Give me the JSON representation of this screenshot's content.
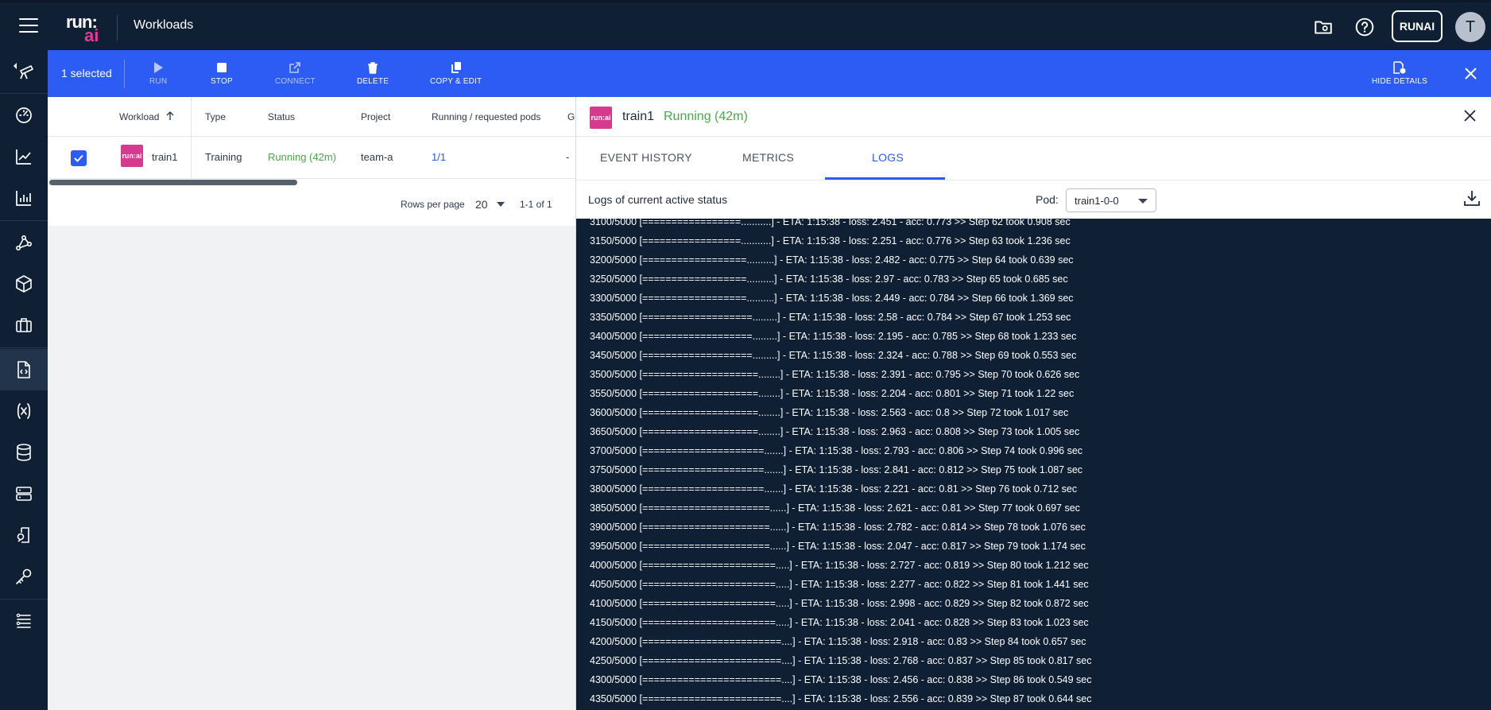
{
  "header": {
    "title": "Workloads",
    "logo_top": "run:",
    "logo_bottom": "ai",
    "org_button": "RUNAI",
    "avatar_letter": "T",
    "icons": [
      "folder-gear-icon",
      "help-icon"
    ]
  },
  "sidebar": {
    "items": [
      "telescope-icon",
      "dashboard-icon",
      "analytics-icon",
      "reports-icon",
      "network-icon",
      "models-icon",
      "briefcase-icon",
      "workloads-icon",
      "variable-icon",
      "datasets-icon",
      "servers-icon",
      "access-icon",
      "key-icon",
      "list-icon"
    ],
    "active_index": 7
  },
  "actionbar": {
    "selected": "1 selected",
    "buttons": [
      {
        "label": "RUN",
        "icon": "play-icon"
      },
      {
        "label": "STOP",
        "icon": "stop-icon"
      },
      {
        "label": "CONNECT",
        "icon": "external-link-icon"
      },
      {
        "label": "DELETE",
        "icon": "trash-icon"
      },
      {
        "label": "COPY & EDIT",
        "icon": "copy-icon"
      }
    ],
    "hide_details": "HIDE DETAILS"
  },
  "table": {
    "headers": [
      "Workload",
      "Type",
      "Status",
      "Project",
      "Running / requested pods",
      "GI"
    ],
    "row": {
      "logo": "run:ai",
      "workload": "train1",
      "type": "Training",
      "status": "Running (42m)",
      "project": "team-a",
      "pods": "1/1",
      "gpu": "-"
    },
    "pager": {
      "rows_per_page_label": "Rows per page",
      "rows_per_page": "20",
      "range": "1-1 of 1"
    }
  },
  "details": {
    "logo": "run:ai",
    "name": "train1",
    "status": "Running (42m)",
    "tabs": [
      "EVENT HISTORY",
      "METRICS",
      "LOGS"
    ],
    "active_tab": "LOGS",
    "logs_title": "Logs of current active status",
    "pod_label": "Pod:",
    "pod_value": "train1-0-0",
    "log_lines": [
      "3100/5000 [=================...........] - ETA: 1:15:38 - loss: 2.451 - acc: 0.773 >> Step 62 took 0.908 sec",
      "3150/5000 [=================...........] - ETA: 1:15:38 - loss: 2.251 - acc: 0.776 >> Step 63 took 1.236 sec",
      "3200/5000 [==================..........] - ETA: 1:15:38 - loss: 2.482 - acc: 0.775 >> Step 64 took 0.639 sec",
      "3250/5000 [==================..........] - ETA: 1:15:38 - loss: 2.97 - acc: 0.783 >> Step 65 took 0.685 sec",
      "3300/5000 [==================..........] - ETA: 1:15:38 - loss: 2.449 - acc: 0.784 >> Step 66 took 1.369 sec",
      "3350/5000 [===================.........] - ETA: 1:15:38 - loss: 2.58 - acc: 0.784 >> Step 67 took 1.253 sec",
      "3400/5000 [===================.........] - ETA: 1:15:38 - loss: 2.195 - acc: 0.785 >> Step 68 took 1.233 sec",
      "3450/5000 [===================.........] - ETA: 1:15:38 - loss: 2.324 - acc: 0.788 >> Step 69 took 0.553 sec",
      "3500/5000 [====================........] - ETA: 1:15:38 - loss: 2.391 - acc: 0.795 >> Step 70 took 0.626 sec",
      "3550/5000 [====================........] - ETA: 1:15:38 - loss: 2.204 - acc: 0.801 >> Step 71 took 1.22 sec",
      "3600/5000 [====================........] - ETA: 1:15:38 - loss: 2.563 - acc: 0.8 >> Step 72 took 1.017 sec",
      "3650/5000 [====================........] - ETA: 1:15:38 - loss: 2.963 - acc: 0.808 >> Step 73 took 1.005 sec",
      "3700/5000 [=====================.......] - ETA: 1:15:38 - loss: 2.793 - acc: 0.806 >> Step 74 took 0.996 sec",
      "3750/5000 [=====================.......] - ETA: 1:15:38 - loss: 2.841 - acc: 0.812 >> Step 75 took 1.087 sec",
      "3800/5000 [=====================.......] - ETA: 1:15:38 - loss: 2.221 - acc: 0.81 >> Step 76 took 0.712 sec",
      "3850/5000 [======================......] - ETA: 1:15:38 - loss: 2.621 - acc: 0.81 >> Step 77 took 0.697 sec",
      "3900/5000 [======================......] - ETA: 1:15:38 - loss: 2.782 - acc: 0.814 >> Step 78 took 1.076 sec",
      "3950/5000 [======================......] - ETA: 1:15:38 - loss: 2.047 - acc: 0.817 >> Step 79 took 1.174 sec",
      "4000/5000 [=======================.....] - ETA: 1:15:38 - loss: 2.727 - acc: 0.819 >> Step 80 took 1.212 sec",
      "4050/5000 [=======================.....] - ETA: 1:15:38 - loss: 2.277 - acc: 0.822 >> Step 81 took 1.441 sec",
      "4100/5000 [=======================.....] - ETA: 1:15:38 - loss: 2.998 - acc: 0.829 >> Step 82 took 0.872 sec",
      "4150/5000 [=======================.....] - ETA: 1:15:38 - loss: 2.041 - acc: 0.828 >> Step 83 took 1.023 sec",
      "4200/5000 [========================....] - ETA: 1:15:38 - loss: 2.918 - acc: 0.83 >> Step 84 took 0.657 sec",
      "4250/5000 [========================....] - ETA: 1:15:38 - loss: 2.768 - acc: 0.837 >> Step 85 took 0.817 sec",
      "4300/5000 [========================....] - ETA: 1:15:38 - loss: 2.456 - acc: 0.838 >> Step 86 took 0.549 sec",
      "4350/5000 [========================....] - ETA: 1:15:38 - loss: 2.556 - acc: 0.839 >> Step 87 took 0.644 sec"
    ]
  },
  "colors": {
    "navy": "#0f2035",
    "accent_blue": "#2d5cf4",
    "running_green": "#4aa84a",
    "brand_pink": "#d63a8e"
  }
}
